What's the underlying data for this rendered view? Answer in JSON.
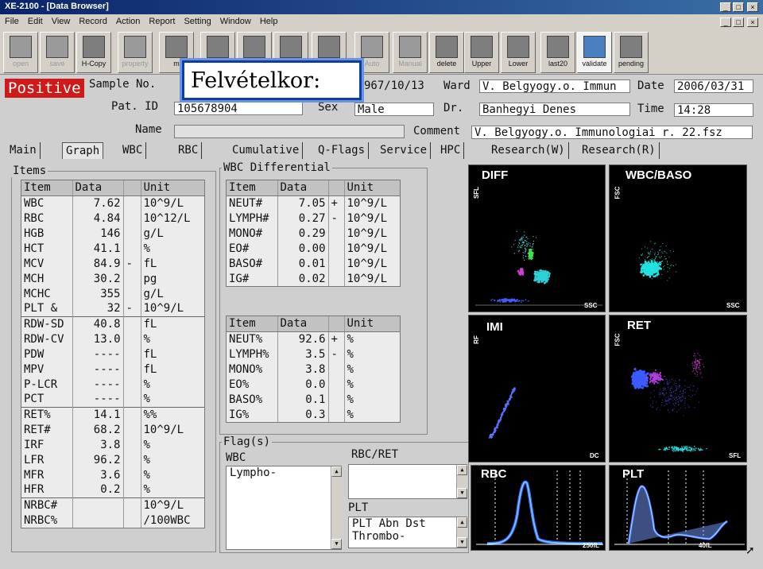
{
  "window": {
    "title": "XE-2100 - [Data Browser]",
    "btn_min": "_",
    "btn_max": "□",
    "btn_close": "×"
  },
  "menu": [
    "File",
    "Edit",
    "View",
    "Record",
    "Action",
    "Report",
    "Setting",
    "Window",
    "Help"
  ],
  "toolbar": [
    {
      "label": "open",
      "state": "disabled"
    },
    {
      "label": "save",
      "state": "disabled"
    },
    {
      "label": "H-Copy",
      "state": "normal"
    },
    {
      "label": "property",
      "state": "disabled"
    },
    {
      "label": "m",
      "state": "normal"
    },
    {
      "label": "",
      "state": "normal"
    },
    {
      "label": "",
      "state": "normal"
    },
    {
      "label": "",
      "state": "normal"
    },
    {
      "label": "",
      "state": "normal"
    },
    {
      "label": "Auto",
      "state": "disabled"
    },
    {
      "label": "Manual",
      "state": "disabled"
    },
    {
      "label": "delete",
      "state": "normal"
    },
    {
      "label": "Upper",
      "state": "normal"
    },
    {
      "label": "Lower",
      "state": "normal"
    },
    {
      "label": "last20",
      "state": "normal"
    },
    {
      "label": "validate",
      "state": "active"
    },
    {
      "label": "pending",
      "state": "normal"
    }
  ],
  "overlay_caption": "Felvételkor:",
  "header": {
    "status": "Positive",
    "sample_no_label": "Sample No.",
    "sample_no_tail": "967/10/13",
    "ward_label": "Ward",
    "ward": "V. Belgyogy.o. Immun",
    "date_label": "Date",
    "date": "2006/03/31",
    "pat_id_label": "Pat. ID",
    "pat_id": "105678904",
    "sex_label": "Sex",
    "sex": "Male",
    "dr_label": "Dr.",
    "dr": "Banhegyi Denes",
    "time_label": "Time",
    "time": "14:28",
    "name_label": "Name",
    "name": "",
    "comment_label": "Comment",
    "comment": "V. Belgyogy.o. Immunologiai r. 22.fsz"
  },
  "tabs": [
    "Main",
    "Graph",
    "WBC",
    "RBC",
    "Cumulative",
    "Q-Flags",
    "Service",
    "HPC",
    "Research(W)",
    "Research(R)"
  ],
  "items_group": {
    "title": "Items",
    "columns": [
      "Item",
      "Data",
      "",
      "Unit"
    ],
    "rows": [
      [
        "WBC",
        "7.62",
        "",
        "10^9/L"
      ],
      [
        "RBC",
        "4.84",
        "",
        "10^12/L"
      ],
      [
        "HGB",
        "146",
        "",
        "g/L"
      ],
      [
        "HCT",
        "41.1",
        "",
        "%"
      ],
      [
        "MCV",
        "84.9",
        "-",
        "fL"
      ],
      [
        "MCH",
        "30.2",
        "",
        "pg"
      ],
      [
        "MCHC",
        "355",
        "",
        "g/L"
      ],
      [
        "PLT   &",
        "32",
        "-",
        "10^9/L"
      ],
      [
        "RDW-SD",
        "40.8",
        "",
        "fL"
      ],
      [
        "RDW-CV",
        "13.0",
        "",
        "%"
      ],
      [
        "PDW",
        "----",
        "",
        "fL"
      ],
      [
        "MPV",
        "----",
        "",
        "fL"
      ],
      [
        "P-LCR",
        "----",
        "",
        "%"
      ],
      [
        "PCT",
        "----",
        "",
        "%"
      ],
      [
        "RET%",
        "14.1",
        "",
        "%%"
      ],
      [
        "RET#",
        "68.2",
        "",
        "10^9/L"
      ],
      [
        "IRF",
        "3.8",
        "",
        "%"
      ],
      [
        "LFR",
        "96.2",
        "",
        "%"
      ],
      [
        "MFR",
        "3.6",
        "",
        "%"
      ],
      [
        "HFR",
        "0.2",
        "",
        "%"
      ],
      [
        "NRBC#",
        "",
        "",
        "10^9/L"
      ],
      [
        "NRBC%",
        "",
        "",
        "/100WBC"
      ]
    ]
  },
  "diff_group": {
    "title": "WBC Differential",
    "columns": [
      "Item",
      "Data",
      "",
      "Unit"
    ],
    "abs_rows": [
      [
        "NEUT#",
        "7.05",
        "+",
        "10^9/L"
      ],
      [
        "LYMPH#",
        "0.27",
        "-",
        "10^9/L"
      ],
      [
        "MONO#",
        "0.29",
        "",
        "10^9/L"
      ],
      [
        "EO#",
        "0.00",
        "",
        "10^9/L"
      ],
      [
        "BASO#",
        "0.01",
        "",
        "10^9/L"
      ],
      [
        "IG#",
        "0.02",
        "",
        "10^9/L"
      ]
    ],
    "pct_rows": [
      [
        "NEUT%",
        "92.6",
        "+",
        "%"
      ],
      [
        "LYMPH%",
        "3.5",
        "-",
        "%"
      ],
      [
        "MONO%",
        "3.8",
        "",
        "%"
      ],
      [
        "EO%",
        "0.0",
        "",
        "%"
      ],
      [
        "BASO%",
        "0.1",
        "",
        "%"
      ],
      [
        "IG%",
        "0.3",
        "",
        "%"
      ]
    ]
  },
  "flags": {
    "title": "Flag(s)",
    "wbc_label": "WBC",
    "wbc": [
      "Lympho-"
    ],
    "rbcret_label": "RBC/RET",
    "rbcret": [],
    "plt_label": "PLT",
    "plt": [
      "PLT Abn Dst",
      "Thrombo-"
    ]
  },
  "plots": {
    "diff": {
      "title": "DIFF",
      "y": "SFL",
      "x": "SSC"
    },
    "wbcbaso": {
      "title": "WBC/BASO",
      "y": "FSC",
      "x": "SSC"
    },
    "imi": {
      "title": "IMI",
      "y": "RF",
      "x": "DC"
    },
    "ret": {
      "title": "RET",
      "y": "FSC",
      "x": "SFL"
    },
    "rbc": {
      "title": "RBC",
      "x": "250fL"
    },
    "plt": {
      "title": "PLT",
      "x": "40fL"
    }
  }
}
